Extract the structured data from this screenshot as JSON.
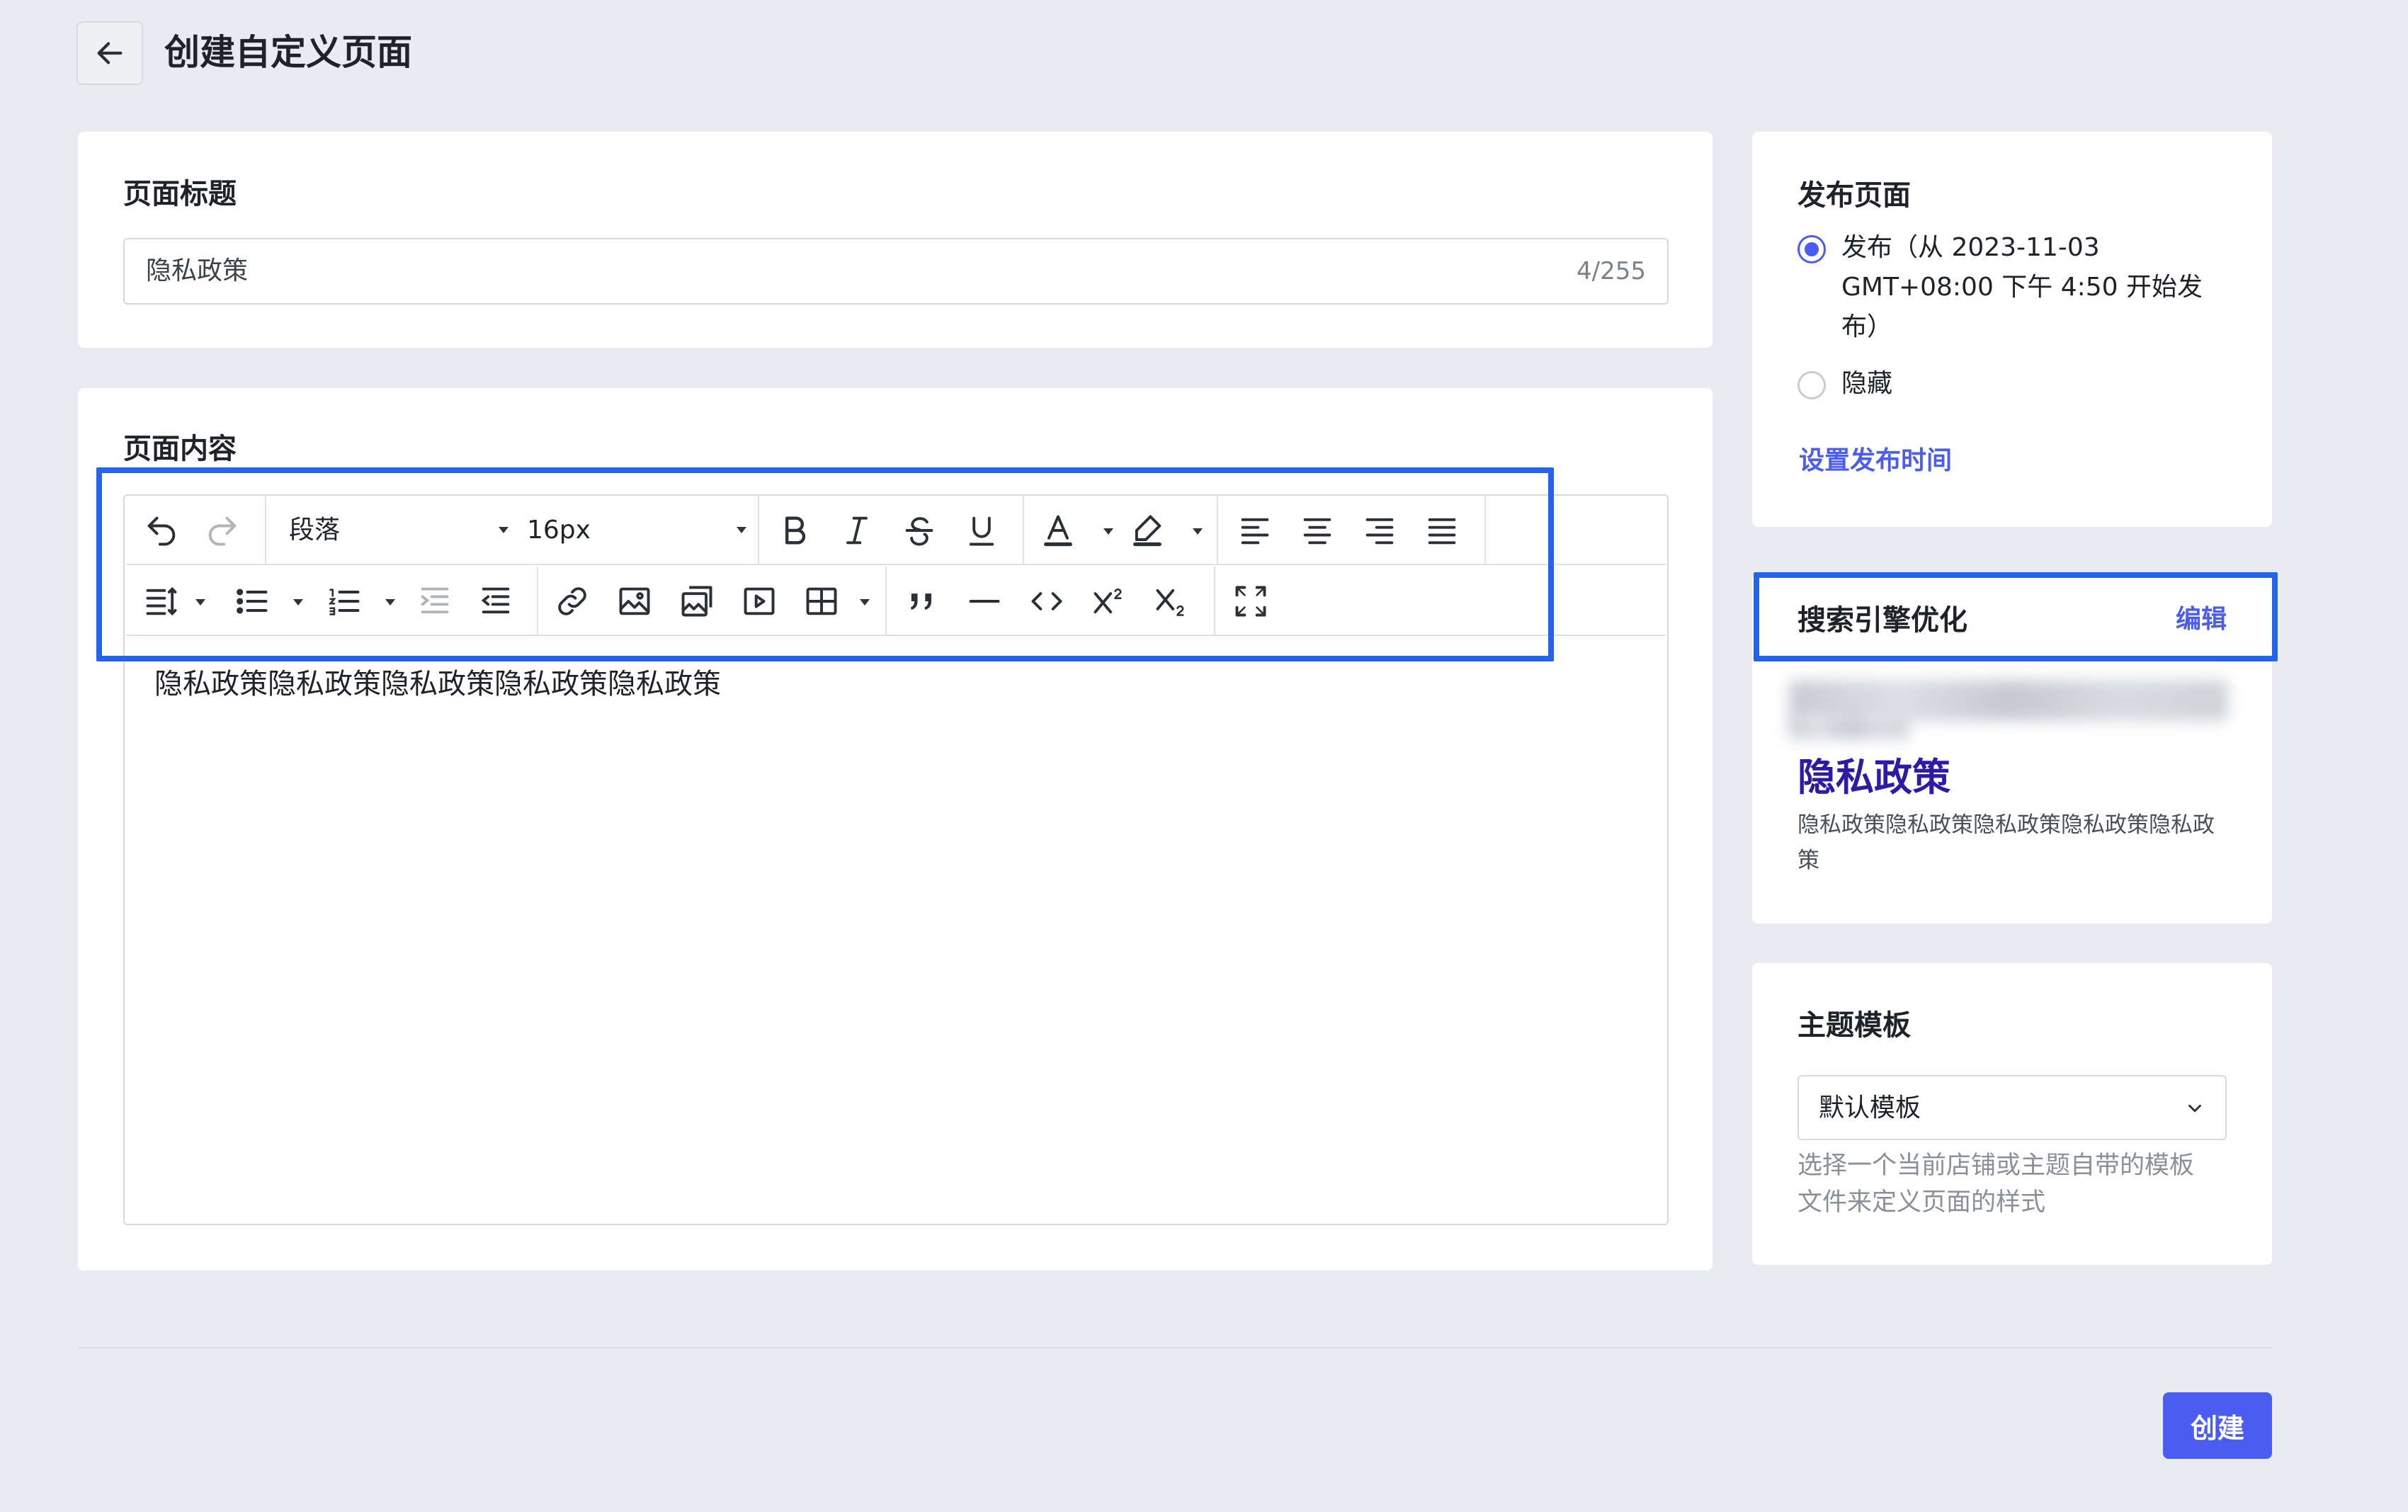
{
  "header": {
    "title": "创建自定义页面"
  },
  "title_card": {
    "label": "页面标题",
    "value": "隐私政策",
    "counter": "4/255"
  },
  "content_card": {
    "label": "页面内容",
    "toolbar": {
      "paragraph_select": "段落",
      "font_size_select": "16px"
    },
    "body_text": "隐私政策隐私政策隐私政策隐私政策隐私政策"
  },
  "publish_card": {
    "title": "发布页面",
    "options": [
      {
        "label_lines": [
          "发布（从 2023-11-03",
          "GMT+08:00 下午 4:50 开始发",
          "布）"
        ],
        "selected": true
      },
      {
        "label_lines": [
          "隐藏"
        ],
        "selected": false
      }
    ],
    "schedule_link": "设置发布时间"
  },
  "seo_card": {
    "title": "搜索引擎优化",
    "edit_link": "编辑",
    "preview_title": "隐私政策",
    "preview_desc_lines": [
      "隐私政策隐私政策隐私政策隐私政策隐私政",
      "策"
    ]
  },
  "theme_card": {
    "title": "主题模板",
    "selected": "默认模板",
    "helper_lines": [
      "选择一个当前店铺或主题自带的模板",
      "文件来定义页面的样式"
    ]
  },
  "footer": {
    "create_button": "创建"
  },
  "colors": {
    "accent": "#4b5cf0",
    "highlight_box": "#2464ec",
    "background": "#e9ebf0"
  },
  "icons": [
    "back-arrow-icon",
    "undo-icon",
    "redo-icon",
    "bold-icon",
    "italic-icon",
    "strikethrough-icon",
    "underline-icon",
    "font-color-icon",
    "highlight-color-icon",
    "align-left-icon",
    "align-center-icon",
    "align-right-icon",
    "align-justify-icon",
    "line-height-icon",
    "bullet-list-icon",
    "numbered-list-icon",
    "indent-icon",
    "outdent-icon",
    "link-icon",
    "image-icon",
    "gallery-icon",
    "video-icon",
    "table-icon",
    "quote-icon",
    "horizontal-rule-icon",
    "code-icon",
    "superscript-icon",
    "subscript-icon",
    "fullscreen-icon",
    "chevron-down-icon"
  ]
}
